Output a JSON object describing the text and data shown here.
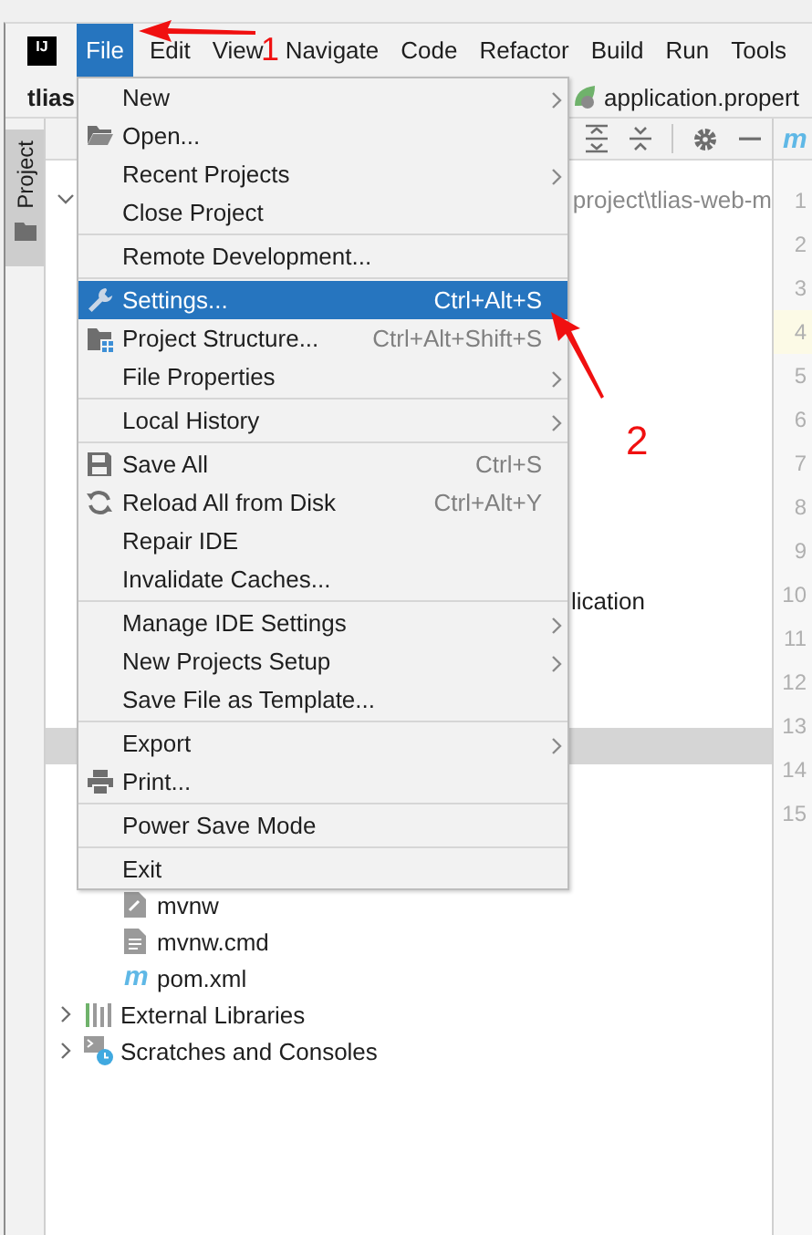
{
  "menubar": {
    "logo": "IJ",
    "items": [
      {
        "label": "File",
        "selected": true
      },
      {
        "label": "Edit",
        "selected": false
      },
      {
        "label": "View",
        "selected": false
      },
      {
        "label": "Navigate",
        "selected": false
      },
      {
        "label": "Code",
        "selected": false
      },
      {
        "label": "Refactor",
        "selected": false
      },
      {
        "label": "Build",
        "selected": false
      },
      {
        "label": "Run",
        "selected": false
      },
      {
        "label": "Tools",
        "selected": false
      }
    ]
  },
  "navbar": {
    "project": "tlias",
    "crumb": "application.propert"
  },
  "tool_strip": {
    "tabs": [
      {
        "label": "Project",
        "selected": true
      }
    ]
  },
  "editor": {
    "tab_icon": "m",
    "lines": [
      {
        "number": "1",
        "current": false
      },
      {
        "number": "2",
        "current": false
      },
      {
        "number": "3",
        "current": false
      },
      {
        "number": "4",
        "current": true
      },
      {
        "number": "5",
        "current": false
      },
      {
        "number": "6",
        "current": false
      },
      {
        "number": "7",
        "current": false
      },
      {
        "number": "8",
        "current": false
      },
      {
        "number": "9",
        "current": false
      },
      {
        "number": "10",
        "current": false
      },
      {
        "number": "11",
        "current": false
      },
      {
        "number": "12",
        "current": false
      },
      {
        "number": "13",
        "current": false
      },
      {
        "number": "14",
        "current": false
      },
      {
        "number": "15",
        "current": false
      }
    ]
  },
  "project_tree": [
    {
      "label": "project\\tlias-web-m",
      "kind": "path",
      "expanded": true,
      "selected": false,
      "children": [
        {
          "label": "lication",
          "kind": "class",
          "selected": false
        },
        {
          "kind": "blank",
          "selected": true
        },
        {
          "label": "mvnw",
          "kind": "script",
          "selected": false
        },
        {
          "label": "mvnw.cmd",
          "kind": "text-file",
          "selected": false
        },
        {
          "label": "pom.xml",
          "kind": "maven",
          "icon_text": "m",
          "selected": false
        }
      ]
    },
    {
      "label": "External Libraries",
      "kind": "libraries",
      "expanded": false,
      "selected": false
    },
    {
      "label": "Scratches and Consoles",
      "kind": "scratches",
      "expanded": false,
      "selected": false
    }
  ],
  "file_menu": {
    "items": [
      {
        "kind": "item",
        "label": "New",
        "submenu": true,
        "selected": false
      },
      {
        "kind": "item",
        "label": "Open...",
        "submenu": false,
        "selected": false
      },
      {
        "kind": "item",
        "label": "Recent Projects",
        "submenu": true,
        "selected": false
      },
      {
        "kind": "item",
        "label": "Close Project",
        "submenu": false,
        "selected": false
      },
      {
        "kind": "separator"
      },
      {
        "kind": "item",
        "label": "Remote Development...",
        "submenu": false,
        "selected": false
      },
      {
        "kind": "separator"
      },
      {
        "kind": "item",
        "label": "Settings...",
        "shortcut": "Ctrl+Alt+S",
        "submenu": false,
        "selected": true
      },
      {
        "kind": "item",
        "label": "Project Structure...",
        "shortcut": "Ctrl+Alt+Shift+S",
        "submenu": false,
        "selected": false
      },
      {
        "kind": "item",
        "label": "File Properties",
        "submenu": true,
        "selected": false
      },
      {
        "kind": "separator"
      },
      {
        "kind": "item",
        "label": "Local History",
        "submenu": true,
        "selected": false
      },
      {
        "kind": "separator"
      },
      {
        "kind": "item",
        "label": "Save All",
        "shortcut": "Ctrl+S",
        "submenu": false,
        "selected": false
      },
      {
        "kind": "item",
        "label": "Reload All from Disk",
        "shortcut": "Ctrl+Alt+Y",
        "submenu": false,
        "selected": false
      },
      {
        "kind": "item",
        "label": "Repair IDE",
        "submenu": false,
        "selected": false
      },
      {
        "kind": "item",
        "label": "Invalidate Caches...",
        "submenu": false,
        "selected": false
      },
      {
        "kind": "separator"
      },
      {
        "kind": "item",
        "label": "Manage IDE Settings",
        "submenu": true,
        "selected": false
      },
      {
        "kind": "item",
        "label": "New Projects Setup",
        "submenu": true,
        "selected": false
      },
      {
        "kind": "item",
        "label": "Save File as Template...",
        "submenu": false,
        "selected": false
      },
      {
        "kind": "separator"
      },
      {
        "kind": "item",
        "label": "Export",
        "submenu": true,
        "selected": false
      },
      {
        "kind": "item",
        "label": "Print...",
        "submenu": false,
        "selected": false
      },
      {
        "kind": "separator"
      },
      {
        "kind": "item",
        "label": "Power Save Mode",
        "submenu": false,
        "selected": false
      },
      {
        "kind": "separator"
      },
      {
        "kind": "item",
        "label": "Exit",
        "submenu": false,
        "selected": false
      }
    ]
  },
  "annotations": [
    {
      "label": "1"
    },
    {
      "label": "2"
    }
  ]
}
